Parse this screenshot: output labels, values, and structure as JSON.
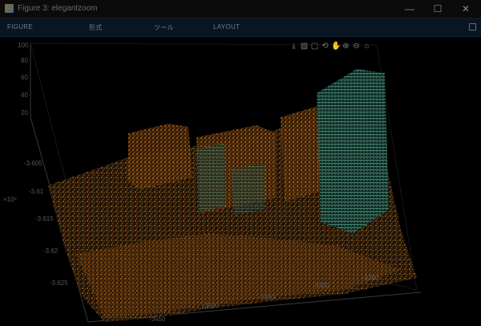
{
  "window": {
    "title": "Figure 3: elegantzoom",
    "min_glyph": "—",
    "max_glyph": "☐",
    "close_glyph": "✕"
  },
  "toolstrip": {
    "tabs": [
      "FIGURE",
      "形式",
      "ツール",
      "LAYOUT"
    ]
  },
  "axes_toolbar": {
    "icons": [
      "export-icon",
      "brush-icon",
      "datatip-icon",
      "rotate-icon",
      "pan-icon",
      "zoom-in-icon",
      "zoom-out-icon",
      "home-icon"
    ]
  },
  "z_axis": {
    "ticks": [
      "100",
      "80",
      "60",
      "40",
      "20"
    ]
  },
  "y_axis": {
    "ticks": [
      "-3.605",
      "-3.61",
      "-3.615",
      "-3.62",
      "-3.625"
    ],
    "exponent": "×10⁶"
  },
  "x_axis": {
    "ticks": [
      "-3450",
      "-3400",
      "-3350",
      "-3300",
      "-3250"
    ]
  },
  "colors": {
    "title_bar": "#0b0b0b",
    "toolstrip": "#0a1524",
    "points_warm": "#a8661c",
    "points_cool": "#3f8a78"
  }
}
